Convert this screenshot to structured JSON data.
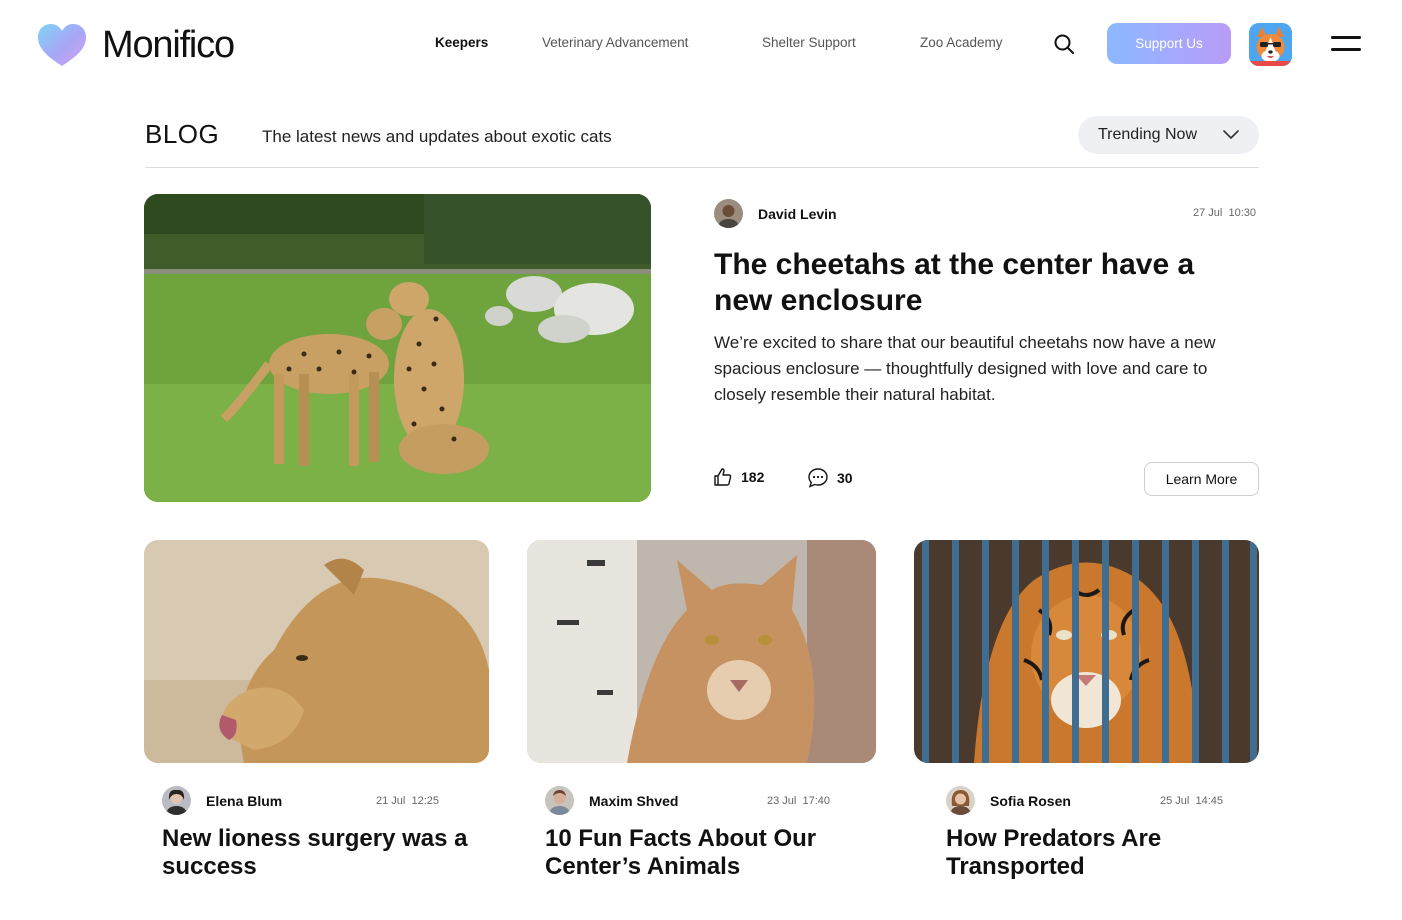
{
  "brand": {
    "name": "Monifico"
  },
  "nav": {
    "items": [
      {
        "label": "Keepers",
        "active": true
      },
      {
        "label": "Veterinary Advancement",
        "active": false
      },
      {
        "label": "Shelter Support",
        "active": false
      },
      {
        "label": "Zoo Academy",
        "active": false
      }
    ],
    "search_icon": "search-icon",
    "support_label": "Support Us",
    "menu_icon": "menu-icon"
  },
  "blog": {
    "title": "BLOG",
    "subtitle": "The latest news and updates about exotic cats",
    "filter_label": "Trending Now"
  },
  "featured": {
    "author": "David Levin",
    "date": "27 Jul",
    "time": "10:30",
    "title": "The cheetahs at the center have a new enclosure",
    "body": "We’re excited to share that our beautiful cheetahs now have a new spacious enclosure — thoughtfully designed with love and care to closely resemble their natural habitat.",
    "likes": "182",
    "comments": "30",
    "cta_label": "Learn More"
  },
  "cards": [
    {
      "author": "Elena Blum",
      "date": "21 Jul",
      "time": "12:25",
      "title": "New lioness surgery was a success"
    },
    {
      "author": "Maxim Shved",
      "date": "23 Jul",
      "time": "17:40",
      "title": "10 Fun Facts About Our Center’s Animals"
    },
    {
      "author": "Sofia Rosen",
      "date": "25 Jul",
      "time": "14:45",
      "title": "How Predators Are Transported"
    }
  ],
  "colors": {
    "accent_gradient_start": "#8bb8ff",
    "accent_gradient_end": "#b99cf8",
    "filter_bg": "#eef0f3"
  }
}
